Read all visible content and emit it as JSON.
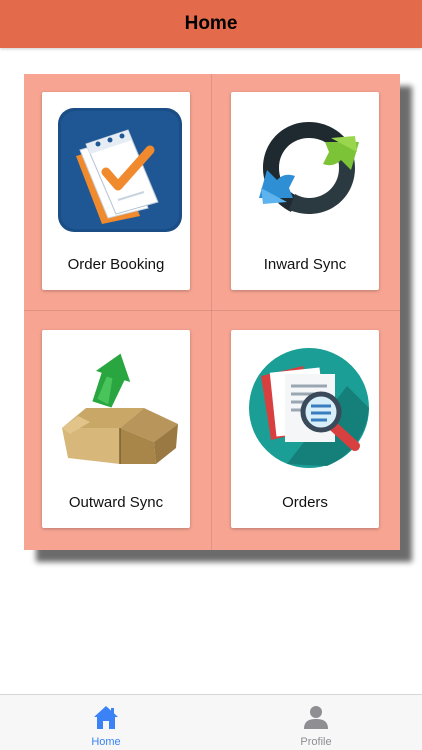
{
  "navbar": {
    "title": "Home"
  },
  "tiles": [
    {
      "label": "Order Booking",
      "icon": "order-booking-icon"
    },
    {
      "label": "Inward Sync",
      "icon": "inward-sync-icon"
    },
    {
      "label": "Outward Sync",
      "icon": "outward-sync-icon"
    },
    {
      "label": "Orders",
      "icon": "orders-icon"
    }
  ],
  "tabbar": {
    "items": [
      {
        "label": "Home",
        "icon": "home-icon",
        "active": true
      },
      {
        "label": "Profile",
        "icon": "profile-icon",
        "active": false
      }
    ]
  },
  "colors": {
    "navbar_bg": "#e46a4c",
    "panel_bg": "#f7a492",
    "tab_active": "#3b82f6",
    "tab_inactive": "#8e8e93"
  }
}
